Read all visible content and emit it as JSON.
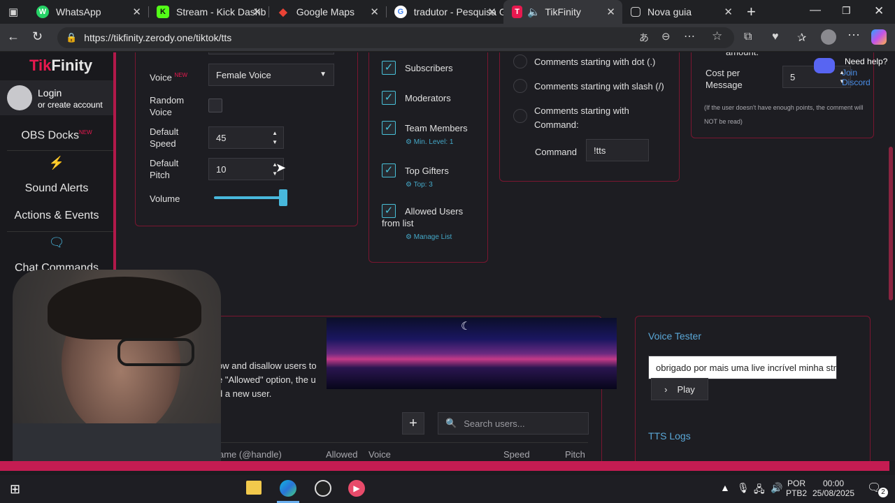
{
  "tabs": [
    {
      "label": "WhatsApp",
      "icon": "whatsapp-icon",
      "color": "#25d366",
      "glyph": "W"
    },
    {
      "label": "Stream - Kick Dashb",
      "icon": "kick-icon",
      "color": "#53fc18",
      "glyph": "K"
    },
    {
      "label": "Google Maps",
      "icon": "maps-pin-icon",
      "color": "#34a853",
      "glyph": "◆"
    },
    {
      "label": "tradutor - Pesquisa G",
      "icon": "google-icon",
      "color": "#4285f4",
      "glyph": "G"
    },
    {
      "label": "TikFinity",
      "icon": "tikfinity-icon",
      "color": "#e8194f",
      "glyph": "T"
    },
    {
      "label": "Nova guia",
      "icon": "new-tab-icon",
      "color": "#5f6368",
      "glyph": "▢"
    }
  ],
  "address": {
    "url": "https://tikfinity.zerody.one/tiktok/tts"
  },
  "sidebar": {
    "brand_a": "Tik",
    "brand_b": "Finity",
    "login": "Login",
    "login_sub": "or create account",
    "obs_docks": "OBS Docks",
    "obs_new": "NEW",
    "sound_alerts": "Sound Alerts",
    "actions_events": "Actions & Events",
    "chat_commands": "Chat Commands"
  },
  "voice_card": {
    "voice_label": "Voice",
    "voice_new": "NEW",
    "voice_value": "Female Voice",
    "random_label": "Random Voice",
    "speed_label": "Default Speed",
    "speed_value": "45",
    "pitch_label": "Default Pitch",
    "pitch_value": "10",
    "volume_label": "Volume",
    "volume_level": 0.95
  },
  "users_card": {
    "subscribers": "Subscribers",
    "moderators": "Moderators",
    "team_members": "Team Members",
    "team_sub": "Min. Level: 1",
    "top_gifters": "Top Gifters",
    "top_sub": "Top: 3",
    "allowed_users": "Allowed Users from list",
    "manage_list": "Manage List"
  },
  "comments_card": {
    "dot": "Comments starting with dot (.)",
    "slash": "Comments starting with slash (/)",
    "command": "Comments starting with Command:",
    "command_label": "Command",
    "command_value": "!tts"
  },
  "points_card": {
    "amount_partial": "amount.",
    "cost_label": "Cost per Message",
    "cost_value": "5",
    "note": "(If the user doesn't have enough points, the comment will NOT be read)",
    "need_help": "Need help?",
    "join_discord": "Join Discord"
  },
  "allowed_section": {
    "line1": "ow and disallow users to",
    "line2": "e \"Allowed\" option, the u",
    "line3": "d a new user.",
    "search_placeholder": "Search users...",
    "col_name": "ame (@handle)",
    "col_allowed": "Allowed",
    "col_voice": "Voice",
    "col_speed": "Speed",
    "col_pitch": "Pitch"
  },
  "voice_tester": {
    "title": "Voice Tester",
    "text": "obrigado por mais uma live incrível minha stre",
    "play": "Play",
    "logs": "TTS Logs"
  },
  "taskbar": {
    "lang": "POR",
    "layout": "PTB2",
    "time": "00:00",
    "date": "25/08/2025",
    "notifications": "2"
  }
}
